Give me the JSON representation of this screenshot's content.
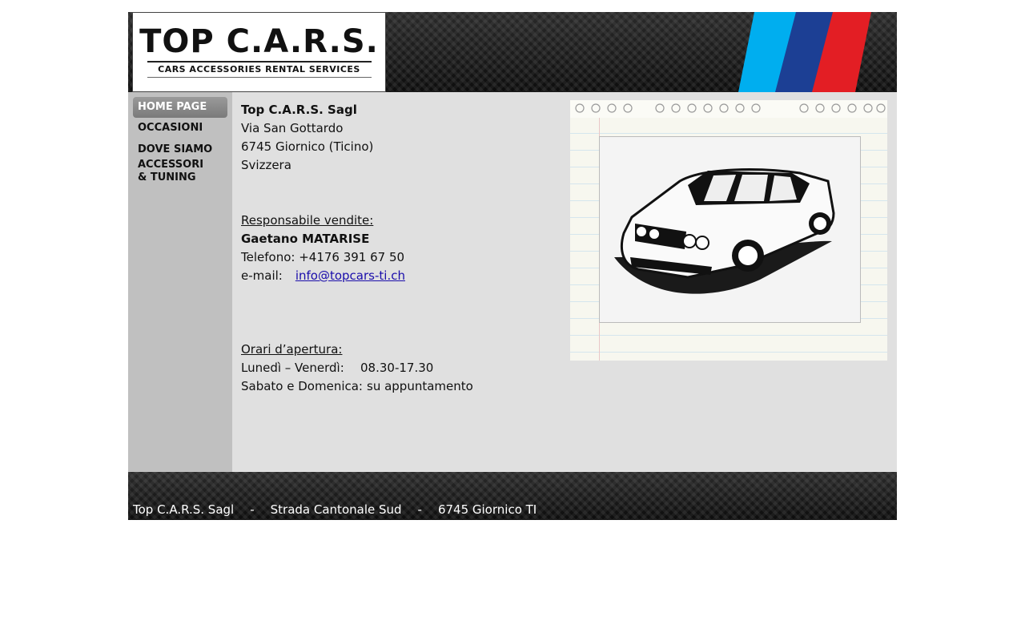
{
  "header": {
    "logo_title": "TOP C.A.R.S.",
    "logo_subtitle": "CARS ACCESSORIES RENTAL SERVICES",
    "stripe_colors": [
      "#00aeef",
      "#1c3f94",
      "#e31e24"
    ]
  },
  "nav": {
    "items": [
      {
        "label": "HOME PAGE"
      },
      {
        "label": "OCCASIONI"
      },
      {
        "label": "DOVE SIAMO"
      },
      {
        "label": "ACCESSORI & TUNING"
      }
    ],
    "active_index": 0
  },
  "company": {
    "name": "Top C.A.R.S. Sagl",
    "street": "Via San Gottardo",
    "city": "6745 Giornico (Ticino)",
    "country": "Svizzera"
  },
  "sales": {
    "heading": "Responsabile vendite:",
    "person": "Gaetano MATARISE",
    "phone": "Telefono: +4176 391 67 50",
    "email_label": "e-mail:",
    "email": "info@topcars-ti.ch"
  },
  "hours": {
    "heading": "Orari d’apertura:",
    "weekdays_label": "Lunedì – Venerdì:",
    "weekdays_value": "08.30-17.30",
    "weekend_label": "Sabato e Domenica:",
    "weekend_value": "su appuntamento"
  },
  "footer": {
    "company": "Top C.A.R.S. Sagl",
    "separator": "-",
    "street": "Strada Cantonale Sud",
    "city": "6745 Giornico TI"
  },
  "colors": {
    "link": "#1a0dab",
    "sidebar": "#c0c0c0",
    "content_bg": "#e0e0e0"
  }
}
